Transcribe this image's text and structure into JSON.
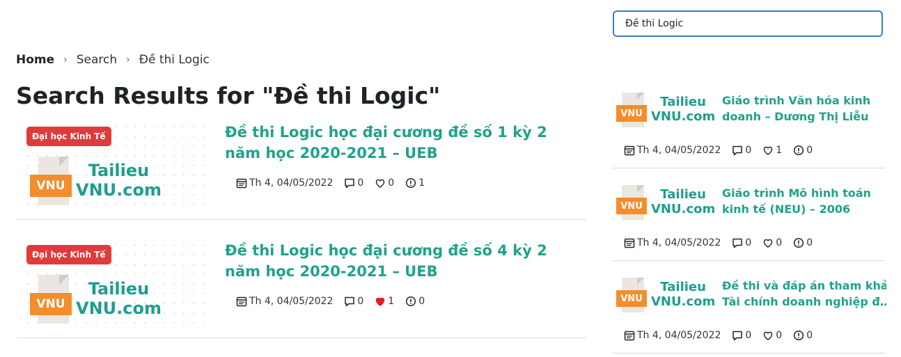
{
  "search": {
    "value": "Đề thi Logic"
  },
  "breadcrumb": {
    "home": "Home",
    "search": "Search",
    "current": "Đề thi Logic"
  },
  "page_title": "Search Results for \"Đề thi Logic\"",
  "logo": {
    "line1": "Tailieu",
    "line2": "VNU.com",
    "tag": "VNU"
  },
  "articles": [
    {
      "category": "Đại học Kinh Tế",
      "title": "Đề thi Logic học đại cương đề số 1 kỳ 2 năm học 2020-2021 – UEB",
      "date": "Th 4, 04/05/2022",
      "comments": "0",
      "likes": "0",
      "views": "1",
      "liked": false
    },
    {
      "category": "Đại học Kinh Tế",
      "title": "Đề thi Logic học đại cương đề số 4 kỳ 2 năm học 2020-2021 – UEB",
      "date": "Th 4, 04/05/2022",
      "comments": "0",
      "likes": "1",
      "views": "0",
      "liked": true
    }
  ],
  "sidebar": [
    {
      "title_line1": "Giáo trình Văn hóa kinh",
      "title_line2": "doanh – Dương Thị Liễu",
      "date": "Th 4, 04/05/2022",
      "comments": "0",
      "likes": "1",
      "views": "0"
    },
    {
      "title_line1": "Giáo trình Mô hình toán",
      "title_line2": "kinh tế (NEU) – 2006",
      "date": "Th 4, 04/05/2022",
      "comments": "0",
      "likes": "0",
      "views": "0"
    },
    {
      "title_line1": "Đề thi và đáp án tham khảo",
      "title_line2": "Tài chính doanh nghiệp đ…",
      "date": "Th 4, 04/05/2022",
      "comments": "0",
      "likes": "0",
      "views": "0"
    }
  ],
  "colors": {
    "accent": "#1fa28b",
    "badge": "#e03b3b",
    "like_active": "#e02020"
  }
}
